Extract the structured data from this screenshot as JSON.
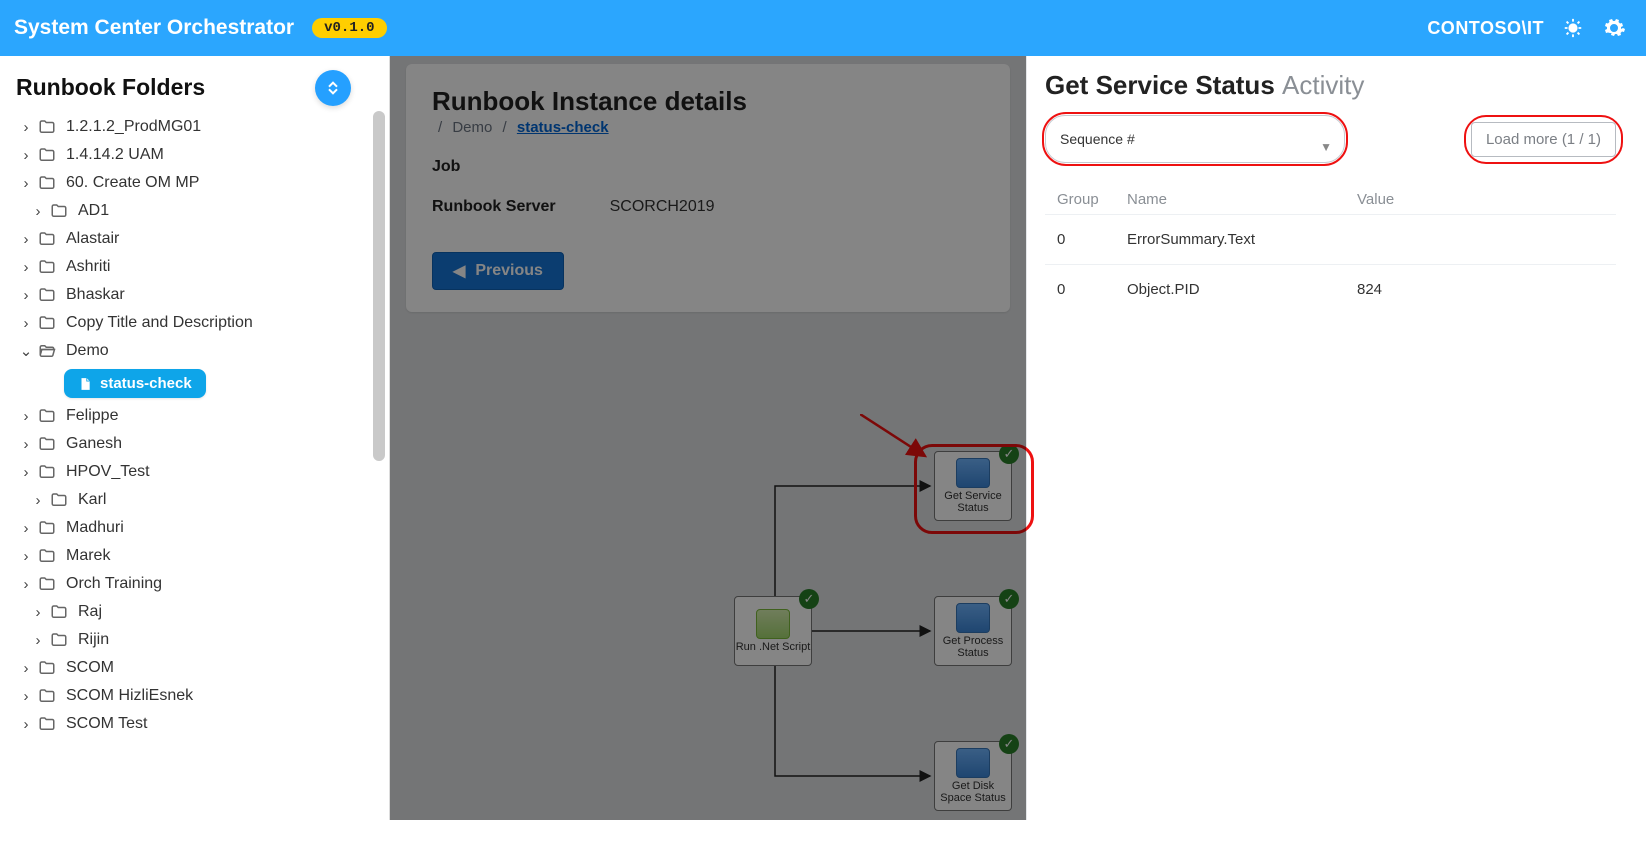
{
  "header": {
    "brand": "System Center Orchestrator",
    "version": "v0.1.0",
    "user": "CONTOSO\\IT"
  },
  "sidebar": {
    "title": "Runbook Folders",
    "selected_file": "status-check",
    "items": [
      {
        "label": "1.2.1.2_ProdMG01",
        "expanded": false,
        "indent": 0
      },
      {
        "label": "1.4.14.2 UAM",
        "expanded": false,
        "indent": 0
      },
      {
        "label": "60. Create OM MP",
        "expanded": false,
        "indent": 0
      },
      {
        "label": "AD1",
        "expanded": false,
        "indent": 1
      },
      {
        "label": "Alastair",
        "expanded": false,
        "indent": 0
      },
      {
        "label": "Ashriti",
        "expanded": false,
        "indent": 0
      },
      {
        "label": "Bhaskar",
        "expanded": false,
        "indent": 0
      },
      {
        "label": "Copy Title and Description",
        "expanded": false,
        "indent": 0
      },
      {
        "label": "Demo",
        "expanded": true,
        "indent": 0
      },
      {
        "label": "Felippe",
        "expanded": false,
        "indent": 0
      },
      {
        "label": "Ganesh",
        "expanded": false,
        "indent": 0
      },
      {
        "label": "HPOV_Test",
        "expanded": false,
        "indent": 0
      },
      {
        "label": "Karl",
        "expanded": false,
        "indent": 1
      },
      {
        "label": "Madhuri",
        "expanded": false,
        "indent": 0
      },
      {
        "label": "Marek",
        "expanded": false,
        "indent": 0
      },
      {
        "label": "Orch Training",
        "expanded": false,
        "indent": 0
      },
      {
        "label": "Raj",
        "expanded": false,
        "indent": 1
      },
      {
        "label": "Rijin",
        "expanded": false,
        "indent": 1
      },
      {
        "label": "SCOM",
        "expanded": false,
        "indent": 0
      },
      {
        "label": "SCOM HizliEsnek",
        "expanded": false,
        "indent": 0
      },
      {
        "label": "SCOM Test",
        "expanded": false,
        "indent": 0
      }
    ]
  },
  "details": {
    "title": "Runbook Instance details",
    "crumb_parent": "Demo",
    "crumb_current": "status-check",
    "job_label": "Job",
    "server_label": "Runbook Server",
    "server_value": "SCORCH2019",
    "prev_button": "Previous"
  },
  "flow": {
    "nodes": {
      "script": {
        "label": "Run .Net Script"
      },
      "service": {
        "label": "Get Service Status"
      },
      "process": {
        "label": "Get Process Status"
      },
      "disk": {
        "label": "Get Disk Space Status"
      }
    }
  },
  "panel": {
    "title_main": "Get Service Status",
    "title_sub": "Activity",
    "sequence_label": "Sequence #",
    "loadmore_label": "Load more (1 / 1)",
    "columns": {
      "group": "Group",
      "name": "Name",
      "value": "Value"
    },
    "rows": [
      {
        "group": "0",
        "name": "ErrorSummary.Text",
        "value": ""
      },
      {
        "group": "0",
        "name": "Object.PID",
        "value": "824"
      }
    ]
  }
}
